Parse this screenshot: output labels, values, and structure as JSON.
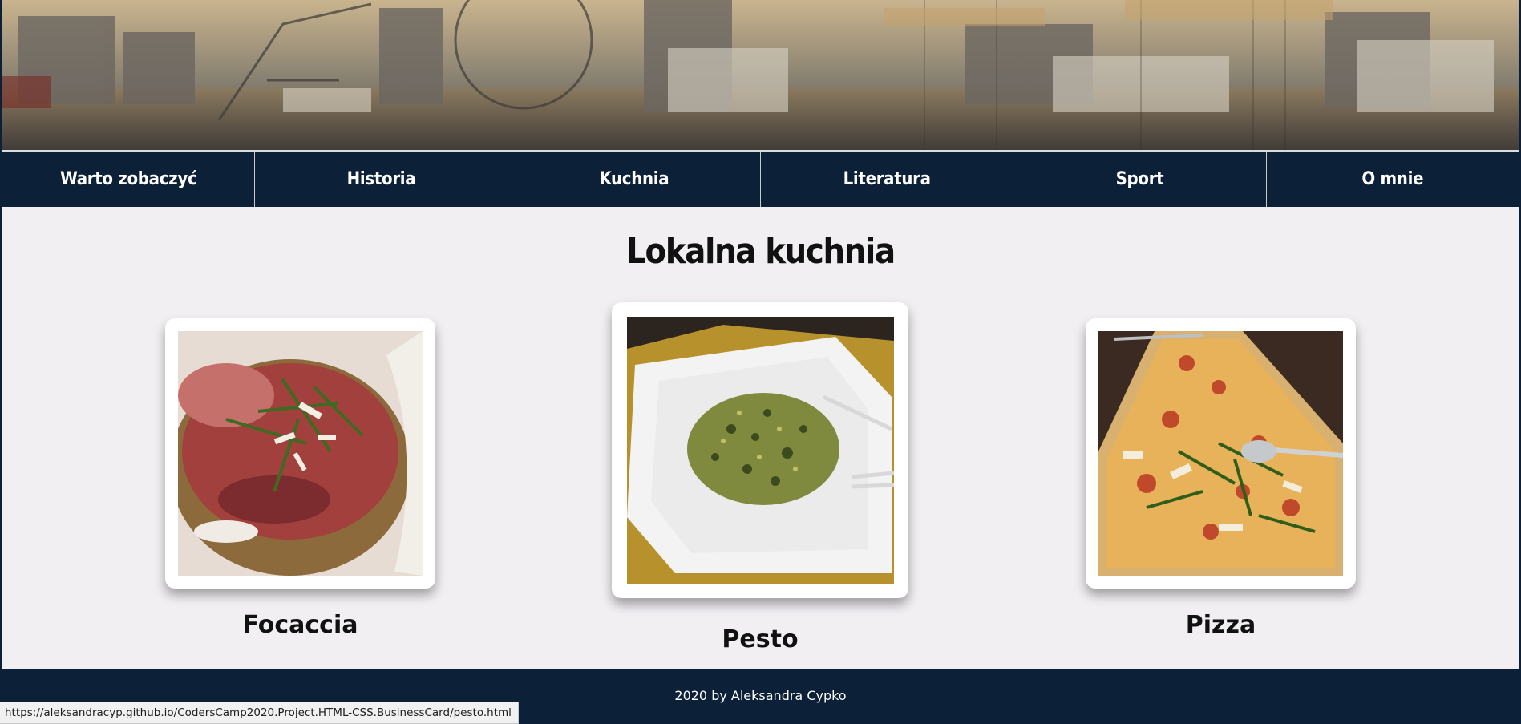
{
  "nav": {
    "items": [
      {
        "label": "Warto zobaczyć"
      },
      {
        "label": "Historia"
      },
      {
        "label": "Kuchnia"
      },
      {
        "label": "Literatura"
      },
      {
        "label": "Sport"
      },
      {
        "label": "O mnie"
      }
    ]
  },
  "main": {
    "title": "Lokalna kuchnia",
    "cards": [
      {
        "caption": "Focaccia"
      },
      {
        "caption": "Pesto"
      },
      {
        "caption": "Pizza"
      }
    ]
  },
  "footer": {
    "text": "2020 by Aleksandra Cypko"
  },
  "status_bar": {
    "url": "https://aleksandracyp.github.io/CodersCamp2020.Project.HTML-CSS.BusinessCard/pesto.html"
  },
  "colors": {
    "navy": "#0c2038",
    "page_bg": "#f2eff3"
  }
}
